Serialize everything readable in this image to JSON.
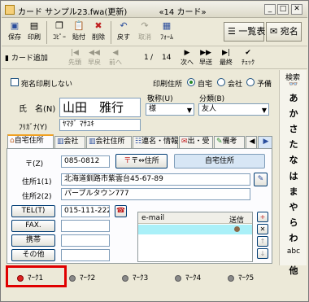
{
  "window": {
    "title": "カード サンプル23.fwa(更新)",
    "card_label": "«14 カード»"
  },
  "toolbar": {
    "save": "保存",
    "print": "印刷",
    "copy": "ｺﾋﾟｰ",
    "paste": "貼付",
    "delete": "削除",
    "undo": "戻す",
    "cancel": "取消",
    "form": "ﾌｫｰﾑ",
    "list": "一覧表",
    "address": "宛名"
  },
  "navbar": {
    "add_card": "カード追加",
    "first": "先頭",
    "fast_back": "早戻",
    "prev": "前へ",
    "position": "1",
    "total": "14",
    "next": "次へ",
    "fast_forward": "早送",
    "last": "最終",
    "check": "ﾁｪｯｸ"
  },
  "header_row": {
    "no_print_label": "宛名印刷しない",
    "print_address_label": "印刷住所",
    "radio_home": "自宅",
    "radio_company": "会社",
    "radio_spare": "予備"
  },
  "person": {
    "name_label": "氏　名(N)",
    "name_value": "山田　雅行",
    "furigana_label": "ﾌﾘｶﾞﾅ(Y)",
    "furigana_value": "ﾔﾏﾀﾞ ﾏｻﾕｷ",
    "honorific_label": "敬称(U)",
    "honorific_value": "様",
    "category_label": "分類(B)",
    "category_value": "友人"
  },
  "tabs": [
    {
      "label": "自宅住所"
    },
    {
      "label": "会社"
    },
    {
      "label": "会社住所"
    },
    {
      "label": "連名・情報"
    },
    {
      "label": "出・受"
    },
    {
      "label": "備考"
    }
  ],
  "address": {
    "zip_label": "〒(Z)",
    "zip_value": "085-0812",
    "zip_button": "〒⇔住所",
    "home_address_button": "自宅住所",
    "addr1_label": "住所1(1)",
    "addr1_value": "北海道釧路市紫雲台45-67-89",
    "addr2_label": "住所2(2)",
    "addr2_value": "パープルタウン777"
  },
  "contact": {
    "tel_label": "TEL(T)",
    "tel_value": "015-111-222",
    "fax_label": "FAX.",
    "mobile_label": "携帯",
    "other_label": "その他",
    "email_header": "e-mail",
    "send_header": "送信"
  },
  "sidebar": {
    "title": "検索",
    "kana": [
      "あ",
      "か",
      "さ",
      "た",
      "な",
      "は",
      "ま",
      "や",
      "ら",
      "わ",
      "abc",
      "他"
    ]
  },
  "marks": [
    {
      "label": "ﾏｰｸ1",
      "active": true
    },
    {
      "label": "ﾏｰｸ2",
      "active": false
    },
    {
      "label": "ﾏｰｸ3",
      "active": false
    },
    {
      "label": "ﾏｰｸ4",
      "active": false
    },
    {
      "label": "ﾏｰｸ5",
      "active": false
    }
  ],
  "colors": {
    "highlight": "#e00000",
    "selected_row": "#aaf0f8",
    "home_address_button": "#d7e6f5"
  }
}
